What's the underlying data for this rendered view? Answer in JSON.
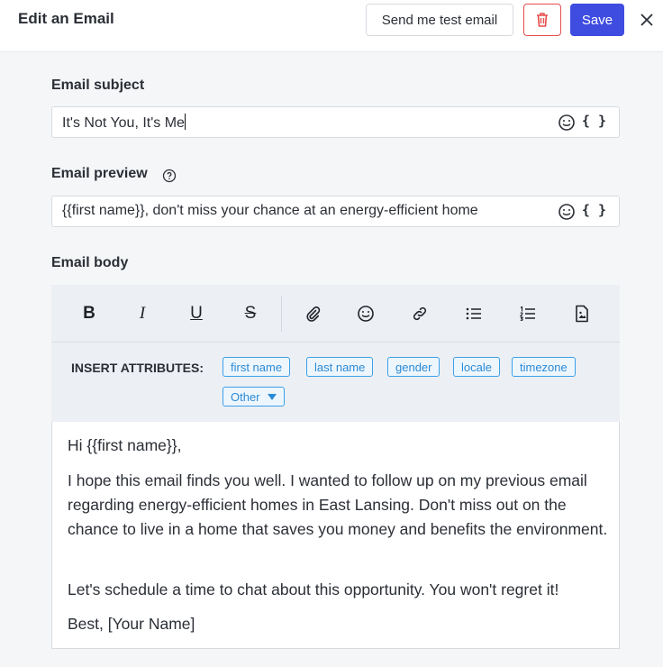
{
  "header": {
    "title": "Edit an Email",
    "test_button": "Send me test email",
    "save_button": "Save"
  },
  "subject": {
    "label": "Email subject",
    "value": "It's Not You, It's Me",
    "braces": "{ }"
  },
  "preview": {
    "label": "Email preview",
    "value": "{{first name}}, don't miss your chance at an energy-efficient home",
    "braces": "{ }"
  },
  "body": {
    "label": "Email body",
    "toolbar": {
      "bold": "B",
      "italic": "I",
      "underline": "U",
      "strike": "S"
    },
    "attributes": {
      "label": "INSERT ATTRIBUTES:",
      "chips": [
        "first name",
        "last name",
        "gender",
        "locale",
        "timezone"
      ],
      "other": "Other"
    },
    "paragraphs": [
      "Hi {{first name}},",
      "I hope this email finds you well. I wanted to follow up on my previous email regarding energy-efficient homes in East Lansing. Don't miss out on the chance to live in a home that saves you money and benefits the environment.",
      "Let's schedule a time to chat about this opportunity. You won't regret it!",
      "Best, [Your Name]"
    ]
  },
  "colors": {
    "primary": "#3f4ce0",
    "danger": "#e74c4c",
    "chip": "#3aa0e8"
  }
}
